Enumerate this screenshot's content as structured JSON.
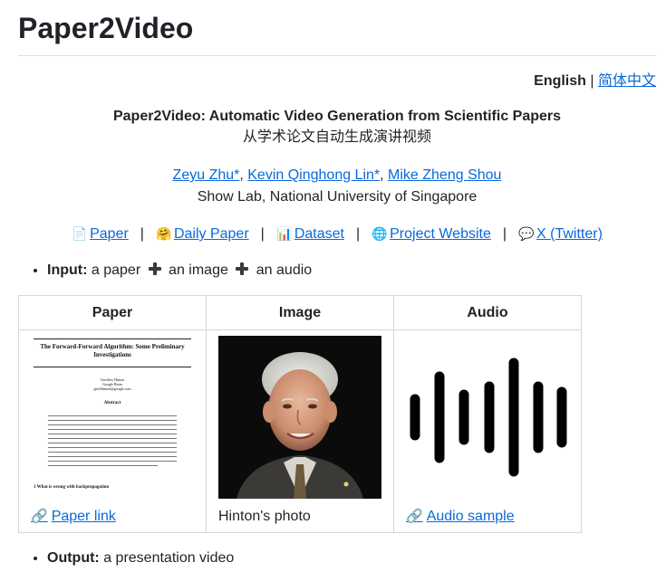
{
  "page": {
    "title": "Paper2Video"
  },
  "language": {
    "current": "English",
    "separator": "|",
    "other": "简体中文"
  },
  "header": {
    "title_en": "Paper2Video: Automatic Video Generation from Scientific Papers",
    "title_zh": "从学术论文自动生成演讲视频"
  },
  "authors": [
    {
      "name": "Zeyu Zhu*"
    },
    {
      "name": "Kevin Qinghong Lin*"
    },
    {
      "name": "Mike Zheng Shou"
    }
  ],
  "affiliation": "Show Lab, National University of Singapore",
  "links": [
    {
      "emoji": "📄",
      "label": "Paper"
    },
    {
      "emoji": "🤗",
      "label": "Daily Paper"
    },
    {
      "emoji": "📊",
      "label": "Dataset"
    },
    {
      "emoji": "🌐",
      "label": "Project Website"
    },
    {
      "emoji": "💬",
      "label": "X (Twitter)"
    }
  ],
  "link_separator": "|",
  "input": {
    "label": "Input:",
    "parts": [
      "a paper",
      "an image",
      "an audio"
    ]
  },
  "table": {
    "headers": [
      "Paper",
      "Image",
      "Audio"
    ],
    "paper": {
      "thumb_title": "The Forward-Forward Algorithm: Some Preliminary Investigations",
      "thumb_author": "Geoffrey Hinton",
      "thumb_org": "Google Brain",
      "thumb_email": "geoffhinton@google.com",
      "thumb_abstract": "Abstract",
      "thumb_section": "1   What is wrong with backpropagation",
      "link_label": "Paper link",
      "link_emoji": "🔗"
    },
    "image": {
      "caption": "Hinton's photo"
    },
    "audio": {
      "link_label": "Audio sample",
      "link_emoji": "🔗"
    }
  },
  "output": {
    "label": "Output:",
    "text": "a presentation video"
  },
  "colors": {
    "link": "#0969da",
    "text": "#1f2328",
    "border": "#d0d7de"
  }
}
